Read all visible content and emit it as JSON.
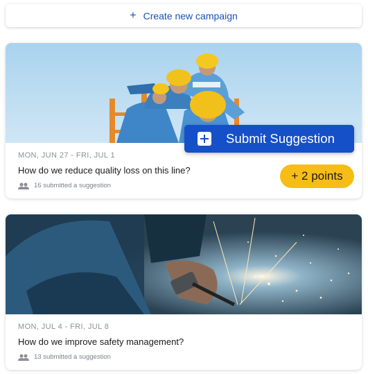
{
  "create_button": {
    "label": "Create new campaign",
    "icon": "plus-icon"
  },
  "campaigns": [
    {
      "date_range": "MON, JUN 27 - FRI, JUL 1",
      "question": "How do we reduce quality loss on this line?",
      "submitted": "16 submitted a suggestion",
      "image": "workers-in-hard-hats-photo"
    },
    {
      "date_range": "MON, JUL 4 - FRI, JUL 8",
      "question": "How do we improve safety management?",
      "submitted": "13 submitted a suggestion",
      "image": "welder-sparks-photo"
    }
  ],
  "submit_suggestion": {
    "label": "Submit Suggestion",
    "icon": "plus-box-icon"
  },
  "points_badge": {
    "label": "+ 2 points"
  },
  "colors": {
    "primary": "#1650c8",
    "link": "#1553b6",
    "badge": "#f6bd16",
    "muted": "#8a8f96"
  }
}
